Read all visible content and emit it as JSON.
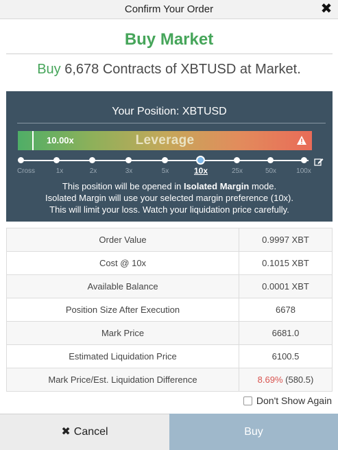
{
  "window": {
    "title": "Confirm Your Order",
    "close_glyph": "✖",
    "close_icon": "close-icon"
  },
  "order": {
    "heading": "Buy Market",
    "summary_side": "Buy",
    "summary_rest": " 6,678 Contracts of XBTUSD at Market."
  },
  "position": {
    "title": "Your Position: XBTUSD",
    "leverage_value": "10.00x",
    "leverage_label": "Leverage",
    "warning_icon": "warning-icon",
    "stops": [
      "Cross",
      "1x",
      "2x",
      "3x",
      "5x",
      "10x",
      "25x",
      "50x",
      "100x"
    ],
    "selected_stop": "10x",
    "info_1a": "This position will be opened in ",
    "info_1b": "Isolated Margin",
    "info_1c": " mode.",
    "info_2": "Isolated Margin will use your selected margin preference (10x).",
    "info_3": "This will limit your loss. Watch your liquidation price carefully."
  },
  "details": {
    "rows": [
      {
        "label": "Order Value",
        "value": "0.9997 XBT"
      },
      {
        "label": "Cost @ 10x",
        "value": "0.1015 XBT"
      },
      {
        "label": "Available Balance",
        "value": "0.0001 XBT"
      },
      {
        "label": "Position Size After Execution",
        "value": "6678"
      },
      {
        "label": "Mark Price",
        "value": "6681.0"
      },
      {
        "label": "Estimated Liquidation Price",
        "value": "6100.5"
      },
      {
        "label": "Mark Price/Est. Liquidation Difference",
        "value_pct": "8.69%",
        "value_abs": " (580.5)"
      }
    ]
  },
  "dont_show_again": {
    "label": "Don't Show Again",
    "checked": false
  },
  "buttons": {
    "cancel_glyph": "✖",
    "cancel": "Cancel",
    "buy": "Buy"
  },
  "colors": {
    "buy_green": "#46a55a",
    "panel_bg": "#3d5262",
    "buy_button": "#9fb8cb",
    "pct_red": "#d9534f"
  }
}
